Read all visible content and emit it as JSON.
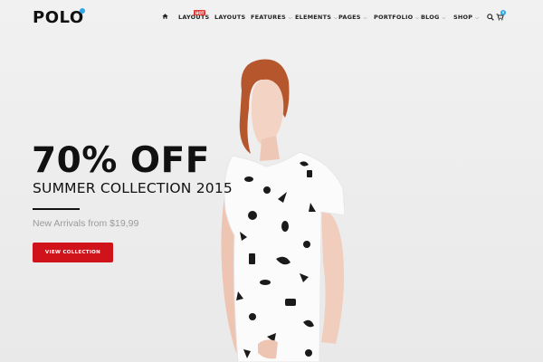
{
  "header": {
    "logo": "POLO",
    "nav": [
      {
        "label": "LAYOUTS",
        "badge": "HOT",
        "dropdown": false
      },
      {
        "label": "LAYOUTS",
        "dropdown": false
      },
      {
        "label": "FEATURES",
        "dropdown": true
      },
      {
        "label": "ELEMENTS",
        "dropdown": true
      },
      {
        "label": "PAGES",
        "dropdown": true
      },
      {
        "label": "PORTFOLIO",
        "dropdown": true
      },
      {
        "label": "BLOG",
        "dropdown": true
      },
      {
        "label": "SHOP",
        "dropdown": true
      }
    ],
    "icons": [
      "home-icon",
      "search-icon",
      "cart-icon"
    ],
    "cart_count": "0"
  },
  "hero": {
    "headline": "70% OFF",
    "subheadline": "SUMMER COLLECTION 2015",
    "tagline": "New Arrivals from $19,99",
    "cta_label": "VIEW COLLECTION"
  },
  "colors": {
    "accent": "#d0121b",
    "badge": "#e53935",
    "logo_dot": "#2fa8e8",
    "text": "#111111",
    "muted": "#9a9a9a",
    "background": "#eeeeee"
  }
}
